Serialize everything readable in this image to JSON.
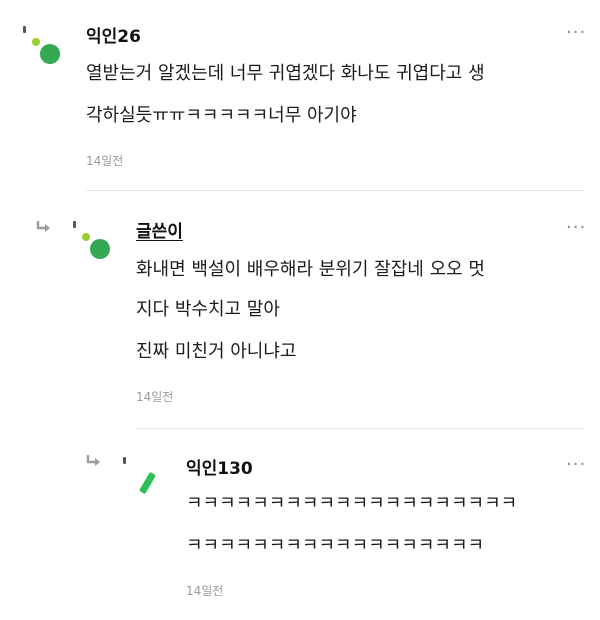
{
  "comments": [
    {
      "author": "익인26",
      "lines": [
        "열받는거 알겠는데 너무 귀엽겠다 화나도 귀엽다고 생",
        "각하실듯ㅠㅠㅋㅋㅋㅋㅋ너무 아기야"
      ],
      "time": "14일전",
      "more": "···",
      "avatar_colors": {
        "small": "#9acd32",
        "big": "#34a853"
      }
    },
    {
      "author": "글쓴이",
      "lines": [
        "화내면 백설이 배우해라 분위기 잘잡네 오오 멋",
        "지다 박수치고 말아",
        "진짜 미친거 아니냐고"
      ],
      "time": "14일전",
      "more": "···",
      "avatar_colors": {
        "small": "#9acd32",
        "big": "#34a853"
      }
    },
    {
      "author": "익인130",
      "lines": [
        "ㅋㅋㅋㅋㅋㅋㅋㅋㅋㅋㅋㅋㅋㅋㅋㅋㅋㅋㅋㅋ",
        "ㅋㅋㅋㅋㅋㅋㅋㅋㅋㅋㅋㅋㅋㅋㅋㅋㅋㅋ"
      ],
      "time": "14일전",
      "more": "···",
      "avatar_colors": {
        "stripe": "#2fbf5a"
      }
    }
  ]
}
